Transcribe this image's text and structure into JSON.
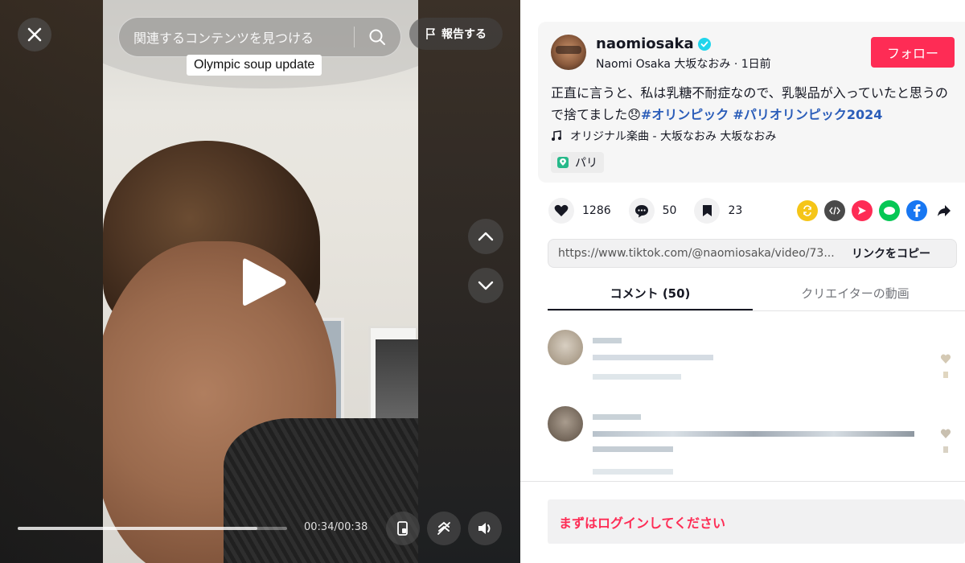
{
  "video": {
    "search_placeholder": "関連するコンテンツを見つける",
    "report_label": "報告する",
    "caption": "Olympic soup update",
    "time": "00:34/00:38",
    "progress": 0.89
  },
  "post": {
    "username": "naomiosaka",
    "display_name_line": "Naomi Osaka 大坂なおみ · 1日前",
    "follow_label": "フォロー",
    "description_text": "正直に言うと、私は乳糖不耐症なので、乳製品が入っていたと思うので捨てました😞",
    "hashtags": [
      "#オリンピック",
      "#パリオリンピック2024"
    ],
    "music": "オリジナル楽曲 - 大坂なおみ 大坂なおみ",
    "location": "パリ"
  },
  "actions": {
    "likes": "1286",
    "comments": "50",
    "saves": "23"
  },
  "share_colors": {
    "repost": "#f5c518",
    "embed": "#4a4a4a",
    "send": "#fe2c55",
    "line": "#06c755",
    "facebook": "#1877f2",
    "more": "#161823"
  },
  "link": {
    "url": "https://www.tiktok.com/@naomiosaka/video/73...",
    "copy_label": "リンクをコピー"
  },
  "tabs": [
    {
      "label": "コメント (50)",
      "active": true
    },
    {
      "label": "クリエイターの動画",
      "active": false
    }
  ],
  "login_prompt": "まずはログインしてください",
  "colors": {
    "accent": "#fe2c55",
    "hashtag": "#2b5db9",
    "verified": "#20d5ec"
  }
}
